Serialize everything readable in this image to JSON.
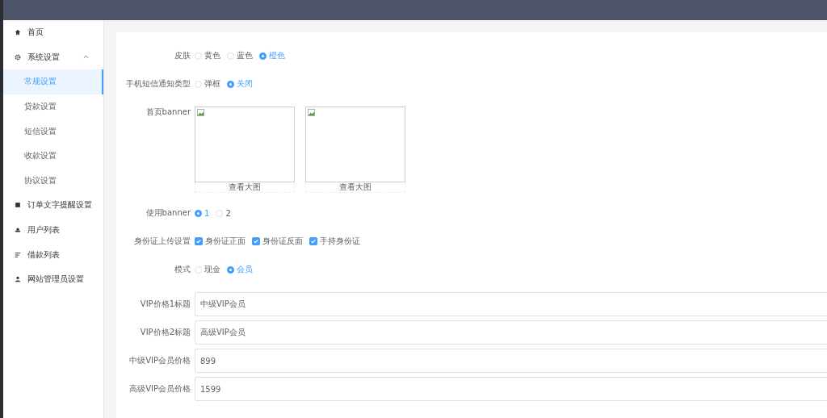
{
  "sidebar": {
    "items": [
      {
        "label": "首页",
        "selected": false
      },
      {
        "label": "系统设置",
        "selected": false,
        "expanded": true,
        "children": [
          {
            "label": "常规设置",
            "selected": true
          },
          {
            "label": "贷款设置",
            "selected": false
          },
          {
            "label": "短信设置",
            "selected": false
          },
          {
            "label": "收款设置",
            "selected": false
          },
          {
            "label": "协议设置",
            "selected": false
          }
        ]
      },
      {
        "label": "订单文字提醒设置",
        "selected": false
      },
      {
        "label": "用户列表",
        "selected": false
      },
      {
        "label": "借款列表",
        "selected": false
      },
      {
        "label": "网站管理员设置",
        "selected": false
      }
    ]
  },
  "form": {
    "rows": [
      {
        "kind": "radio",
        "label": "皮肤",
        "options": [
          {
            "label": "黄色",
            "selected": false
          },
          {
            "label": "蓝色",
            "selected": false
          },
          {
            "label": "橙色",
            "selected": true
          }
        ]
      },
      {
        "kind": "radio",
        "label": "手机短信通知类型",
        "options": [
          {
            "label": "弹框",
            "selected": false
          },
          {
            "label": "关闭",
            "selected": true
          }
        ]
      },
      {
        "kind": "images",
        "label": "首页banner",
        "images": [
          {
            "caption": "查看大图"
          },
          {
            "caption": "查看大图"
          }
        ]
      },
      {
        "kind": "radio",
        "label": "使用banner",
        "options": [
          {
            "label": "1",
            "selected": true
          },
          {
            "label": "2",
            "selected": false
          }
        ]
      },
      {
        "kind": "checkbox",
        "label": "身份证上传设置",
        "options": [
          {
            "label": "身份证正面",
            "checked": true
          },
          {
            "label": "身份证反面",
            "checked": true
          },
          {
            "label": "手持身份证",
            "checked": true
          }
        ]
      },
      {
        "kind": "radio",
        "label": "模式",
        "options": [
          {
            "label": "现金",
            "selected": false
          },
          {
            "label": "会员",
            "selected": true
          }
        ]
      },
      {
        "kind": "input",
        "label": "VIP价格1标题",
        "value": "中级VIP会员"
      },
      {
        "kind": "input",
        "label": "VIP价格2标题",
        "value": "高级VIP会员"
      },
      {
        "kind": "input",
        "label": "中级VIP会员价格",
        "value": "899"
      },
      {
        "kind": "input",
        "label": "高级VIP会员价格",
        "value": "1599"
      }
    ]
  }
}
